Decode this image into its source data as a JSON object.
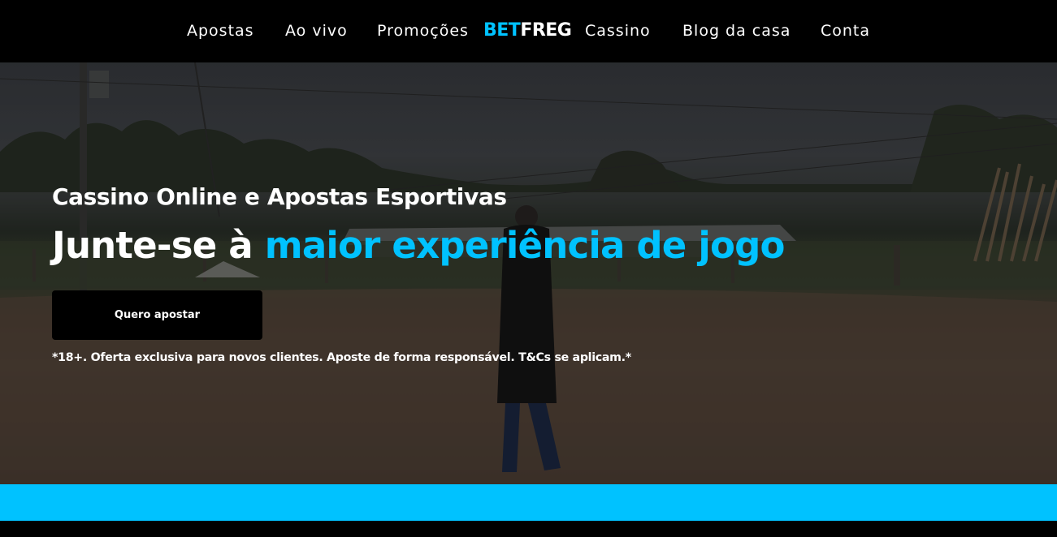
{
  "nav": {
    "items_left": [
      {
        "label": "Apostas"
      },
      {
        "label": "Ao vivo"
      },
      {
        "label": "Promoções"
      }
    ],
    "logo": {
      "bet": "BET",
      "freg": "FREG"
    },
    "items_right": [
      {
        "label": "Cassino"
      },
      {
        "label": "Blog da casa"
      },
      {
        "label": "Conta"
      }
    ]
  },
  "hero": {
    "subtitle": "Cassino Online e Apostas Esportivas",
    "headline_white": "Junte-se à ",
    "headline_accent": "maior experiência de jogo",
    "cta_label": "Quero apostar",
    "disclaimer": "*18+. Oferta exclusiva para novos clientes. Aposte de forma responsável. T&Cs se aplicam.*"
  },
  "colors": {
    "accent": "#00c2ff",
    "background": "#000000",
    "text": "#ffffff"
  }
}
